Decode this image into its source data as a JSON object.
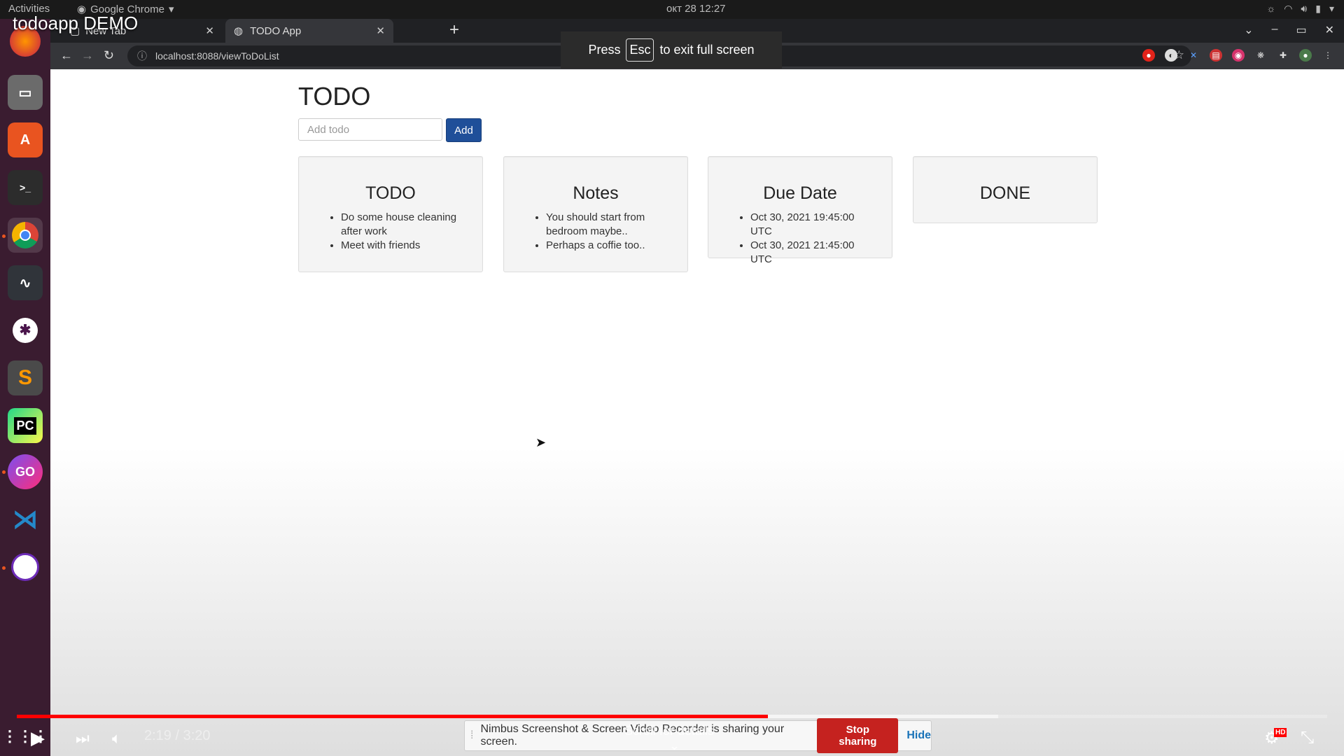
{
  "video_title": "todoapp DEMO",
  "os": {
    "activities": "Activities",
    "app_name": "Google Chrome",
    "clock": "окт 28  12:27"
  },
  "browser": {
    "tabs": [
      {
        "label": "New Tab"
      },
      {
        "label": "TODO App"
      }
    ],
    "url": "localhost:8088/viewToDoList",
    "fullscreen_msg": {
      "press": "Press",
      "key": "Esc",
      "rest": "to exit full screen"
    }
  },
  "page": {
    "title": "TODO",
    "add_input": {
      "placeholder": "Add todo",
      "value": ""
    },
    "add_button": "Add",
    "columns": [
      {
        "title": "TODO",
        "items": [
          "Do some house cleaning after work",
          "Meet with friends"
        ]
      },
      {
        "title": "Notes",
        "items": [
          "You should start from bedroom maybe..",
          "Perhaps a coffie too.."
        ]
      },
      {
        "title": "Due Date",
        "items": [
          "Oct 30, 2021 19:45:00 UTC",
          "Oct 30, 2021 21:45:00 UTC"
        ]
      },
      {
        "title": "DONE",
        "items": []
      }
    ]
  },
  "player": {
    "time": "2:19 / 3:20",
    "played_fraction": 0.573,
    "buffered_fraction": 0.749,
    "scroll_hint": "Scroll for details",
    "hd_badge": "HD"
  },
  "share_bar": {
    "message": "Nimbus Screenshot & Screen Video Recorder is sharing your screen.",
    "stop": "Stop sharing",
    "hide": "Hide"
  },
  "colors": {
    "add_button": "#1f4f99",
    "progress_played": "#ff0000",
    "stop_sharing": "#c5221f"
  }
}
